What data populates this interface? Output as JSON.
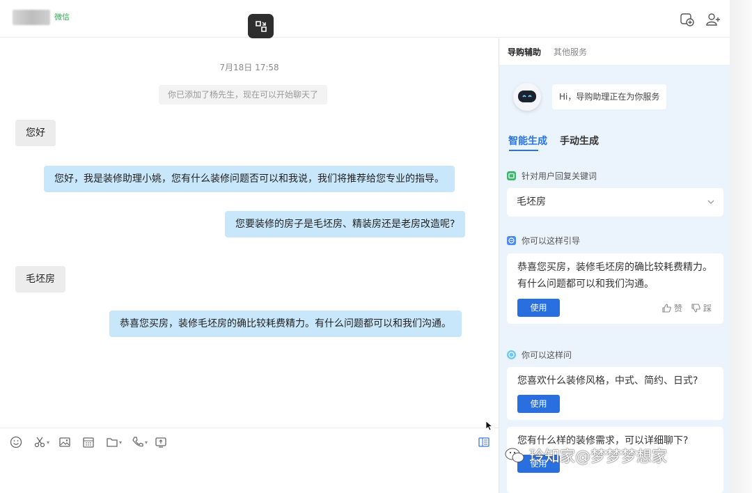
{
  "header": {
    "account_label": "微信",
    "icons": [
      "collapse-icon",
      "chat-add-icon",
      "add-user-icon"
    ]
  },
  "chat": {
    "timestamp": "7月18日  17:58",
    "system_note": "你已添加了杨先生，现在可以开始聊天了",
    "messages": [
      {
        "side": "left",
        "text": "您好"
      },
      {
        "side": "right",
        "text": "您好，我是装修助理小姚，您有什么装修问题否可以和我说，我们将推荐给您专业的指导。"
      },
      {
        "side": "right",
        "text": "您要装修的房子是毛坯房、精装房还是老房改造呢?"
      },
      {
        "side": "left",
        "text": "毛坯房"
      },
      {
        "side": "right",
        "text": "恭喜您买房，装修毛坯房的确比较耗费精力。有什么问题都可以和我们沟通。"
      }
    ]
  },
  "toolbar": {
    "icons": [
      "emoji-icon",
      "scissors-icon",
      "image-icon",
      "calendar-icon",
      "folder-icon",
      "phone-icon",
      "screen-share-icon",
      "sidebar-toggle-icon"
    ]
  },
  "panel": {
    "tabs": [
      "导购辅助",
      "其他服务"
    ],
    "bot_greeting": "Hi，导购助理正在为你服务",
    "gen_tabs": [
      "智能生成",
      "手动生成"
    ],
    "keyword_section": "针对用户回复关键词",
    "keyword_value": "毛坯房",
    "guide_section": "你可以这样引导",
    "guide_text_line1": "恭喜您买房，装修毛坯房的确比较耗费精力。",
    "guide_text_line2": "有什么问题都可以和我们沟通。",
    "use_label": "使用",
    "like_label": "赞",
    "dislike_label": "踩",
    "ask_section": "你可以这样问",
    "ask_text_1": "您喜欢什么装修风格，中式、简约、日式?",
    "ask_text_2": "您有什么样的装修需求，可以详细聊下?"
  },
  "watermark": "玲知家@梦梦梦想家",
  "colors": {
    "accent": "#2a73e3",
    "bubble_self": "#c9e7fb",
    "bubble_other": "#ececec",
    "panel_bg": "#ebf3fc",
    "wechat_green": "#2bae4f"
  }
}
